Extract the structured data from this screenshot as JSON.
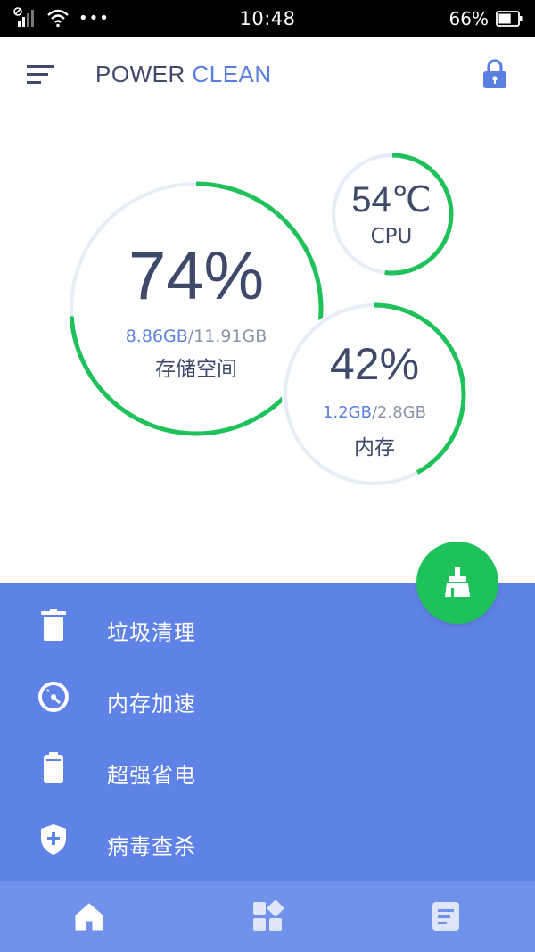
{
  "status_bar": {
    "time": "10:48",
    "battery_percent": "66%",
    "icons": [
      "signal-icon",
      "wifi-icon",
      "more-dots-icon",
      "battery-icon"
    ],
    "dots": "•••"
  },
  "app_bar": {
    "title_part1": "POWER",
    "title_part2": "CLEAN",
    "icons": [
      "menu-icon",
      "lock-icon"
    ]
  },
  "colors": {
    "accent_blue": "#5b7fe0",
    "panel_blue": "#5f82e6",
    "nav_blue": "#7092ea",
    "green": "#1fc25a",
    "track": "#e6ecf8",
    "text_dark": "#3f4a6b"
  },
  "storage": {
    "percent_text": "74%",
    "percent_value": 74,
    "used": "8.86GB",
    "separator_total": "/11.91GB",
    "label": "存储空间"
  },
  "cpu": {
    "temperature": "54℃",
    "label": "CPU",
    "percent_value": 52
  },
  "memory": {
    "percent_text": "42%",
    "percent_value": 42,
    "used": "1.2GB",
    "separator_total": "/2.8GB",
    "label": "内存"
  },
  "menu": [
    {
      "label": "垃圾清理",
      "icon": "trash-icon"
    },
    {
      "label": "内存加速",
      "icon": "speedometer-icon"
    },
    {
      "label": "超强省电",
      "icon": "battery-saver-icon"
    },
    {
      "label": "病毒查杀",
      "icon": "shield-plus-icon"
    }
  ],
  "fab": {
    "icon": "broom-icon"
  },
  "bottom_nav": [
    {
      "icon": "home-icon"
    },
    {
      "icon": "apps-icon"
    },
    {
      "icon": "document-icon"
    }
  ]
}
